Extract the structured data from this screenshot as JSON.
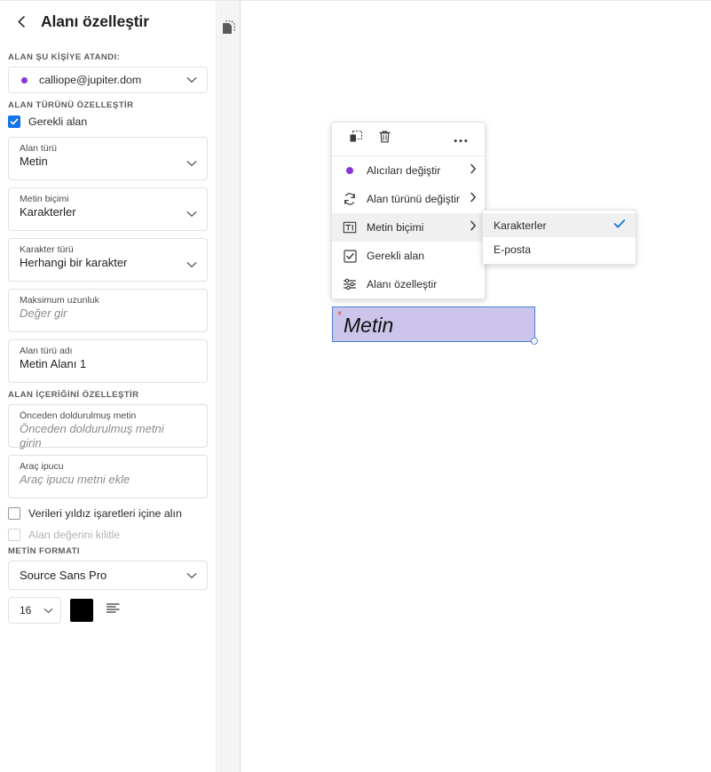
{
  "sidebar": {
    "back_icon": "chevron-left-icon",
    "title": "Alanı özelleştir",
    "sections": {
      "assigned": {
        "label": "ALAN ŞU KİŞİYE ATANDI:",
        "assignee": "calliope@jupiter.dom",
        "dot_color": "#8636d6"
      },
      "field_type": {
        "label": "ALAN TÜRÜNÜ ÖZELLEŞTİR",
        "required_checkbox": {
          "label": "Gerekli alan",
          "checked": true
        },
        "fields": [
          {
            "label": "Alan türü",
            "value": "Metin",
            "placeholder": false
          },
          {
            "label": "Metin biçimi",
            "value": "Karakterler",
            "placeholder": false
          },
          {
            "label": "Karakter türü",
            "value": "Herhangi bir karakter",
            "placeholder": false
          },
          {
            "label": "Maksimum uzunluk",
            "value": "Değer gir",
            "placeholder": true
          },
          {
            "label": "Alan türü adı",
            "value": "Metin Alanı 1",
            "placeholder": false
          }
        ]
      },
      "field_content": {
        "label": "ALAN İÇERİĞİNİ ÖZELLEŞTİR",
        "fields": [
          {
            "label": "Önceden doldurulmuş metin",
            "value": "Önceden doldurulmuş metni girin",
            "placeholder": true
          },
          {
            "label": "Araç ipucu",
            "value": "Araç ipucu metni ekle",
            "placeholder": true
          }
        ],
        "checkboxes": [
          {
            "label": "Verileri yıldız işaretleri içine alın",
            "checked": false,
            "disabled": false
          },
          {
            "label": "Alan değerini kilitle",
            "checked": false,
            "disabled": true
          }
        ]
      },
      "text_format": {
        "label": "METİN FORMATI",
        "font_family": "Source Sans Pro",
        "font_size": "16",
        "color_swatch": "#000000",
        "align_icon": "align-left-icon"
      }
    }
  },
  "rail": {
    "pages_icon": "pages-document-icon"
  },
  "context_menu": {
    "toolbar": [
      {
        "icon": "duplicate-icon",
        "name": "duplicate-button"
      },
      {
        "icon": "trash-icon",
        "name": "delete-button"
      },
      {
        "icon": "more-options-icon",
        "name": "more-options-button"
      }
    ],
    "items": [
      {
        "icon": "recipient-dot-icon",
        "label": "Alıcıları değiştir",
        "has_submenu": true,
        "active": false
      },
      {
        "icon": "change-field-type-icon",
        "label": "Alan türünü değiştir",
        "has_submenu": true,
        "active": false
      },
      {
        "icon": "text-format-icon",
        "label": "Metin biçimi",
        "has_submenu": true,
        "active": true
      },
      {
        "icon": "checkbox-checked-icon",
        "label": "Gerekli alan",
        "has_submenu": false,
        "active": false
      },
      {
        "icon": "sliders-icon",
        "label": "Alanı özelleştir",
        "has_submenu": false,
        "active": false
      }
    ]
  },
  "submenu": {
    "items": [
      {
        "label": "Karakterler",
        "selected": true
      },
      {
        "label": "E-posta",
        "selected": false
      }
    ],
    "check_color": "#1473e6"
  },
  "form_field": {
    "required_marker": "*",
    "text": "Metin",
    "fill_color": "#cdc4ec",
    "border_color": "#4a7fd4"
  }
}
